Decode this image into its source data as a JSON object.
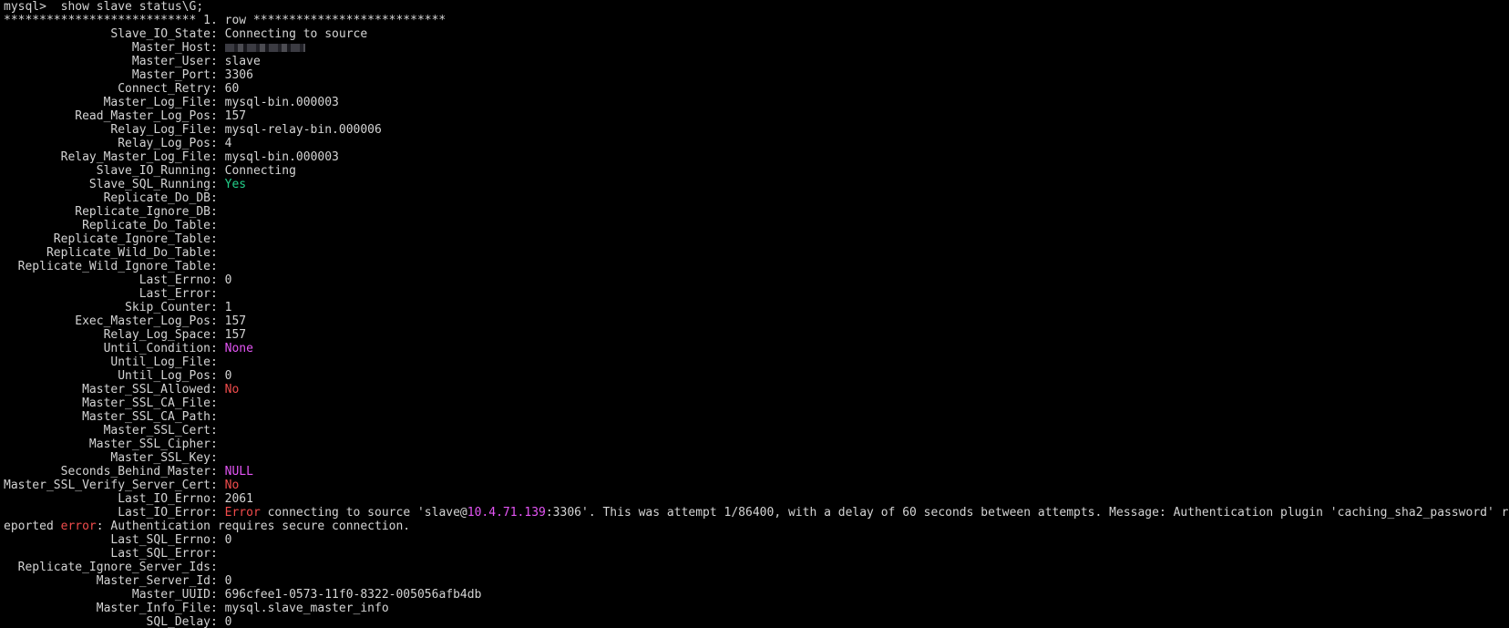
{
  "terminal": {
    "prompt": "mysql>",
    "command": "  show slave status\\G;",
    "row_header": "*************************** 1. row ***************************",
    "fields": [
      {
        "name": "Slave_IO_State",
        "value": "Connecting to source",
        "color": ""
      },
      {
        "name": "Master_Host",
        "value": "",
        "color": "",
        "masked": true
      },
      {
        "name": "Master_User",
        "value": "slave",
        "color": ""
      },
      {
        "name": "Master_Port",
        "value": "3306",
        "color": ""
      },
      {
        "name": "Connect_Retry",
        "value": "60",
        "color": ""
      },
      {
        "name": "Master_Log_File",
        "value": "mysql-bin.000003",
        "color": ""
      },
      {
        "name": "Read_Master_Log_Pos",
        "value": "157",
        "color": ""
      },
      {
        "name": "Relay_Log_File",
        "value": "mysql-relay-bin.000006",
        "color": ""
      },
      {
        "name": "Relay_Log_Pos",
        "value": "4",
        "color": ""
      },
      {
        "name": "Relay_Master_Log_File",
        "value": "mysql-bin.000003",
        "color": ""
      },
      {
        "name": "Slave_IO_Running",
        "value": "Connecting",
        "color": ""
      },
      {
        "name": "Slave_SQL_Running",
        "value": "Yes",
        "color": "green"
      },
      {
        "name": "Replicate_Do_DB",
        "value": "",
        "color": ""
      },
      {
        "name": "Replicate_Ignore_DB",
        "value": "",
        "color": ""
      },
      {
        "name": "Replicate_Do_Table",
        "value": "",
        "color": ""
      },
      {
        "name": "Replicate_Ignore_Table",
        "value": "",
        "color": ""
      },
      {
        "name": "Replicate_Wild_Do_Table",
        "value": "",
        "color": ""
      },
      {
        "name": "Replicate_Wild_Ignore_Table",
        "value": "",
        "color": ""
      },
      {
        "name": "Last_Errno",
        "value": "0",
        "color": ""
      },
      {
        "name": "Last_Error",
        "value": "",
        "color": ""
      },
      {
        "name": "Skip_Counter",
        "value": "1",
        "color": ""
      },
      {
        "name": "Exec_Master_Log_Pos",
        "value": "157",
        "color": ""
      },
      {
        "name": "Relay_Log_Space",
        "value": "157",
        "color": ""
      },
      {
        "name": "Until_Condition",
        "value": "None",
        "color": "magenta"
      },
      {
        "name": "Until_Log_File",
        "value": "",
        "color": ""
      },
      {
        "name": "Until_Log_Pos",
        "value": "0",
        "color": ""
      },
      {
        "name": "Master_SSL_Allowed",
        "value": "No",
        "color": "red"
      },
      {
        "name": "Master_SSL_CA_File",
        "value": "",
        "color": ""
      },
      {
        "name": "Master_SSL_CA_Path",
        "value": "",
        "color": ""
      },
      {
        "name": "Master_SSL_Cert",
        "value": "",
        "color": ""
      },
      {
        "name": "Master_SSL_Cipher",
        "value": "",
        "color": ""
      },
      {
        "name": "Master_SSL_Key",
        "value": "",
        "color": ""
      },
      {
        "name": "Seconds_Behind_Master",
        "value": "NULL",
        "color": "magenta"
      },
      {
        "name": "Master_SSL_Verify_Server_Cert",
        "value": "No",
        "color": "red"
      },
      {
        "name": "Last_IO_Errno",
        "value": "2061",
        "color": ""
      },
      {
        "name": "Last_IO_Error",
        "wrap": true,
        "segments": [
          {
            "text": "Error",
            "color": "red"
          },
          {
            "text": " connecting to source 'slave@",
            "color": ""
          },
          {
            "text": "10.4.71.139",
            "color": "magenta"
          },
          {
            "text": ":3306'. This was attempt 1/86400, with a delay of 60 seconds between attempts. Message: Authentication plugin 'caching_sha2_password' reported ",
            "color": ""
          },
          {
            "text": "error",
            "color": "red"
          },
          {
            "text": ": Authentication requires secure connection.",
            "color": ""
          }
        ]
      },
      {
        "name": "Last_SQL_Errno",
        "value": "0",
        "color": ""
      },
      {
        "name": "Last_SQL_Error",
        "value": "",
        "color": ""
      },
      {
        "name": "Replicate_Ignore_Server_Ids",
        "value": "",
        "color": ""
      },
      {
        "name": "Master_Server_Id",
        "value": "0",
        "color": ""
      },
      {
        "name": "Master_UUID",
        "value": "696cfee1-0573-11f0-8322-005056afb4db",
        "color": ""
      },
      {
        "name": "Master_Info_File",
        "value": "mysql.slave_master_info",
        "color": ""
      },
      {
        "name": "SQL_Delay",
        "value": "0",
        "color": ""
      }
    ]
  }
}
